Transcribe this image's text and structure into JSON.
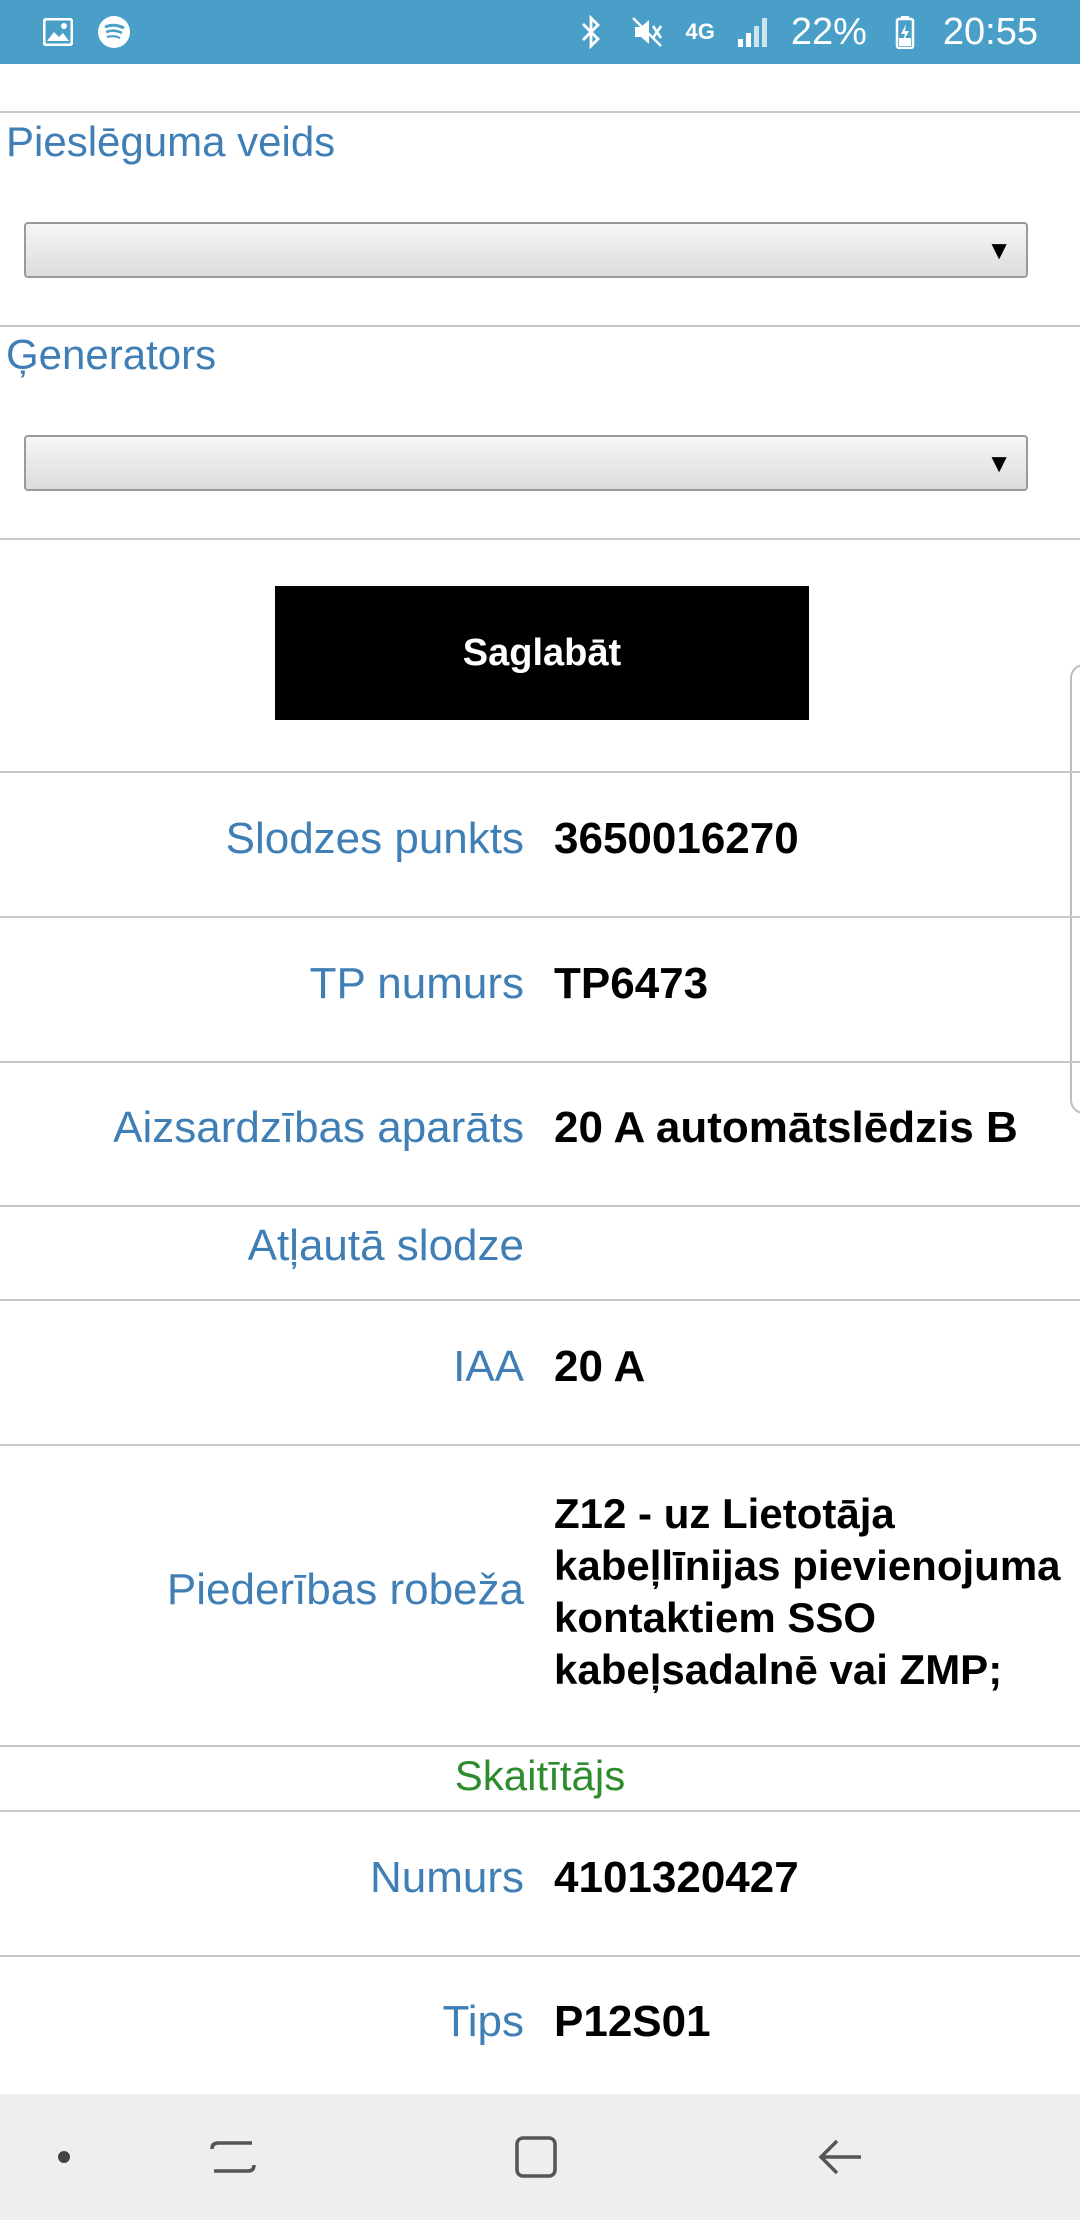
{
  "statusbar": {
    "battery": "22%",
    "time": "20:55",
    "network": "4G",
    "icons": [
      "gallery-icon",
      "spotify-icon",
      "bluetooth-icon",
      "mute-icon",
      "signal-icon",
      "battery-icon"
    ]
  },
  "form": {
    "connection_type": {
      "label": "Pieslēguma veids",
      "value": ""
    },
    "generators": {
      "label": "Ģenerators",
      "value": ""
    },
    "save_label": "Saglabāt"
  },
  "details": {
    "load_point": {
      "label": "Slodzes punkts",
      "value": "3650016270"
    },
    "tp_number": {
      "label": "TP numurs",
      "value": "TP6473"
    },
    "protection": {
      "label": "Aizsardzības aparāts",
      "value": "20 A automātslēdzis B"
    },
    "allowed_load": {
      "label": "Atļautā slodze"
    },
    "iaa": {
      "label": "IAA",
      "value": "20 A"
    },
    "boundary": {
      "label": "Piederības robeža",
      "value": "Z12 - uz Lietotāja kabeļlīnijas pievienojuma kontaktiem SSO kabeļsadalnē vai ZMP;"
    }
  },
  "meter": {
    "section_title": "Skaitītājs",
    "number": {
      "label": "Numurs",
      "value": "4101320427"
    },
    "type": {
      "label": "Tips",
      "value": "P12S01"
    }
  },
  "colors": {
    "statusbar": "#4a9fc8",
    "label_blue": "#3f7fb5",
    "section_green": "#2e8b2e",
    "button_bg": "#000000"
  }
}
